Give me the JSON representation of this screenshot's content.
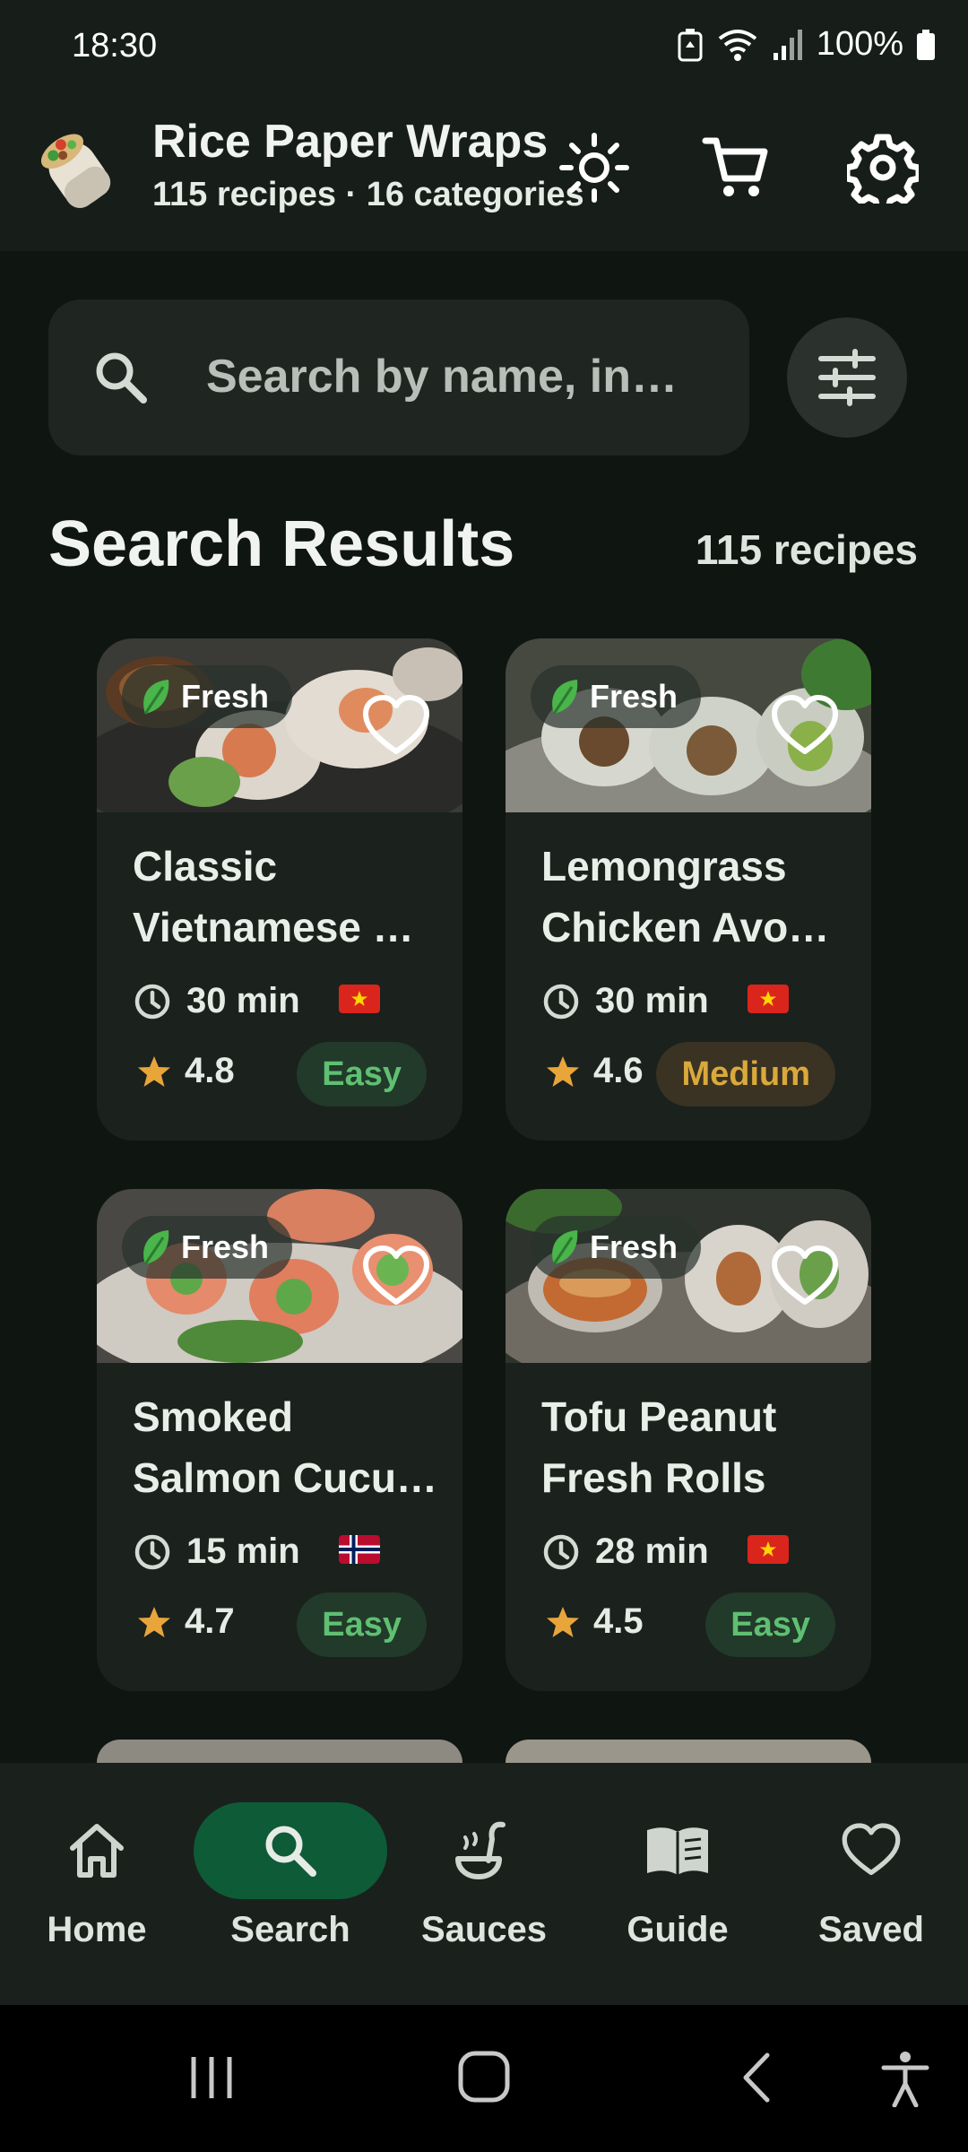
{
  "status": {
    "time": "18:30",
    "battery": "100%"
  },
  "app": {
    "title": "Rice Paper Wraps",
    "subtitle": "115 recipes · 16 categories"
  },
  "search": {
    "placeholder": "Search by name, in…"
  },
  "results": {
    "title": "Search Results",
    "count": "115 recipes"
  },
  "cards": [
    {
      "badge": "Fresh",
      "name_line1": "Classic",
      "name_line2": "Vietnamese …",
      "time": "30 min",
      "flag": "vietnam",
      "rating": "4.8",
      "difficulty": "Easy"
    },
    {
      "badge": "Fresh",
      "name_line1": "Lemongrass",
      "name_line2": "Chicken Avo…",
      "time": "30 min",
      "flag": "vietnam",
      "rating": "4.6",
      "difficulty": "Medium"
    },
    {
      "badge": "Fresh",
      "name_line1": "Smoked",
      "name_line2": "Salmon Cucu…",
      "time": "15 min",
      "flag": "norway",
      "rating": "4.7",
      "difficulty": "Easy"
    },
    {
      "badge": "Fresh",
      "name_line1": "Tofu Peanut",
      "name_line2": "Fresh Rolls",
      "time": "28 min",
      "flag": "vietnam",
      "rating": "4.5",
      "difficulty": "Easy"
    }
  ],
  "nav": [
    {
      "label": "Home",
      "icon": "home-icon"
    },
    {
      "label": "Search",
      "icon": "search-icon",
      "active": true
    },
    {
      "label": "Sauces",
      "icon": "sauce-ladle-icon"
    },
    {
      "label": "Guide",
      "icon": "book-icon"
    },
    {
      "label": "Saved",
      "icon": "heart-icon"
    }
  ],
  "colors": {
    "background": "#0f1511",
    "surface": "#1b211d",
    "accent": "#0e5b37",
    "easy": "#5fbf72",
    "medium": "#d9a93c",
    "star": "#e8a53a"
  }
}
